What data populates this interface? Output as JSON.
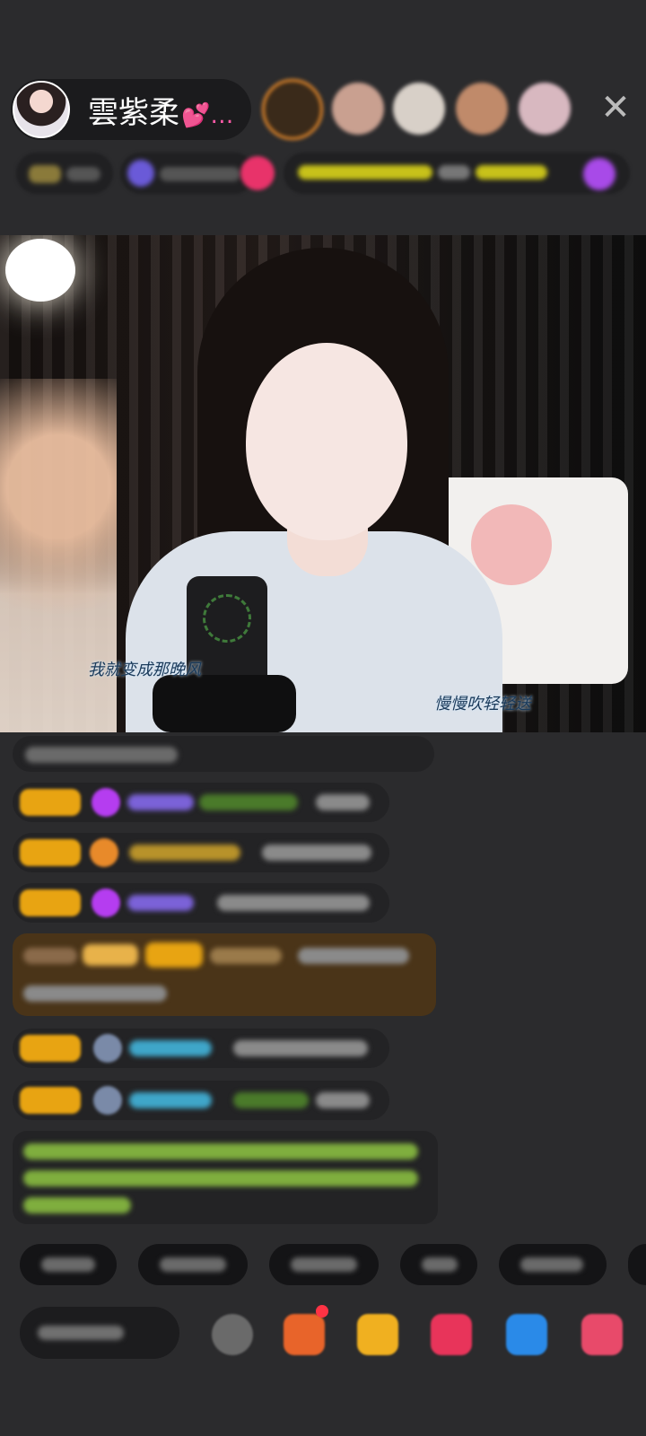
{
  "header": {
    "host_name": "雲紫柔",
    "host_hearts": "💕…",
    "close_glyph": "✕",
    "viewer_colors": [
      "#e88a2a",
      "#c9a090",
      "#d8d0c8",
      "#c08a6a",
      "#d8b8c0"
    ]
  },
  "video": {
    "lyric_left": "我就变成那晚风",
    "lyric_right": "慢慢吹轻轻送"
  },
  "colors": {
    "background": "#2b2b2d",
    "badge_gold": "#e8a412",
    "gem_purple": "#b53df0",
    "highlight_brown": "#4a3418",
    "system_green": "#7fae3e",
    "username_blue": "#3fa6c9",
    "username_gold": "#d39a1a"
  },
  "icons": {
    "close": "close-icon",
    "emoji": "emoji-icon",
    "gift_box": "gift-box-icon",
    "red_packet": "red-packet-icon",
    "heart_gift": "heart-gift-icon",
    "game": "game-icon",
    "more": "more-icon"
  }
}
